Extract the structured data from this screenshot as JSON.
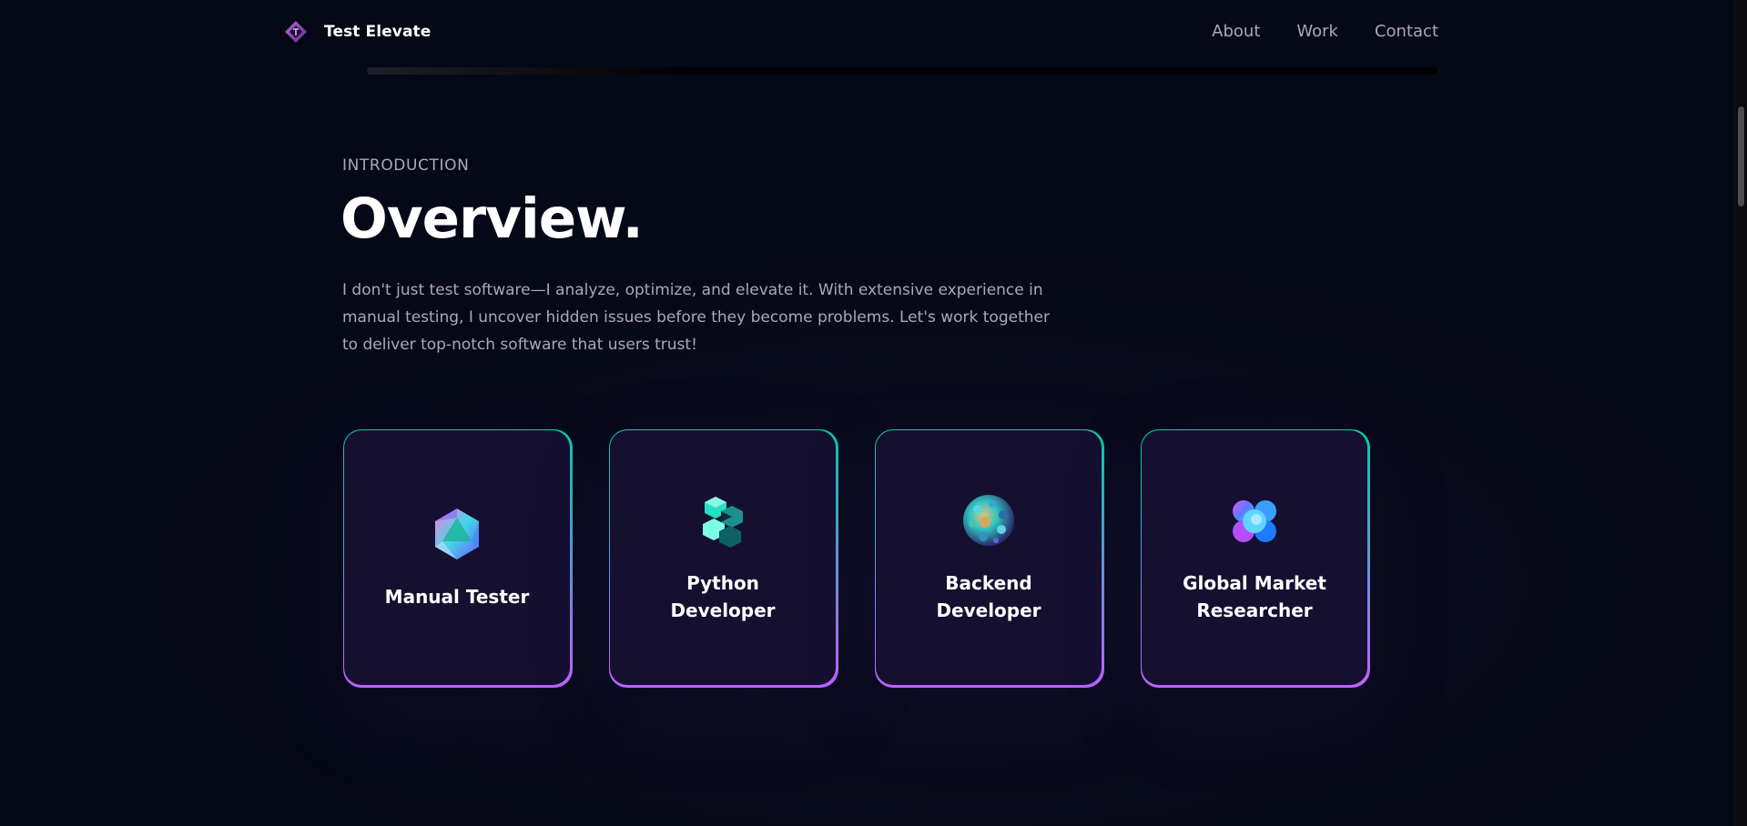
{
  "brand": {
    "name": "Test Elevate",
    "logo_icon": "diamond-logo-icon"
  },
  "nav": {
    "links": [
      {
        "label": "About"
      },
      {
        "label": "Work"
      },
      {
        "label": "Contact"
      }
    ]
  },
  "intro": {
    "label": "Introduction",
    "title": "Overview.",
    "text": "I don't just test software—I analyze, optimize, and elevate it. With extensive experience in manual testing, I uncover hidden issues before they become problems. Let's work together to deliver top-notch software that users trust!"
  },
  "services": [
    {
      "title": "Manual Tester",
      "icon": "icosahedron-icon"
    },
    {
      "title": "Python Developer",
      "icon": "cube-cluster-icon"
    },
    {
      "title": "Backend Developer",
      "icon": "sphere-icon"
    },
    {
      "title": "Global Market Researcher",
      "icon": "blob-cross-icon"
    }
  ],
  "colors": {
    "background": "#050816",
    "card": "#151030",
    "card_border_top": "#00cea8",
    "card_border_bottom": "#bf61ff",
    "secondary_text": "#aaa6c3"
  }
}
